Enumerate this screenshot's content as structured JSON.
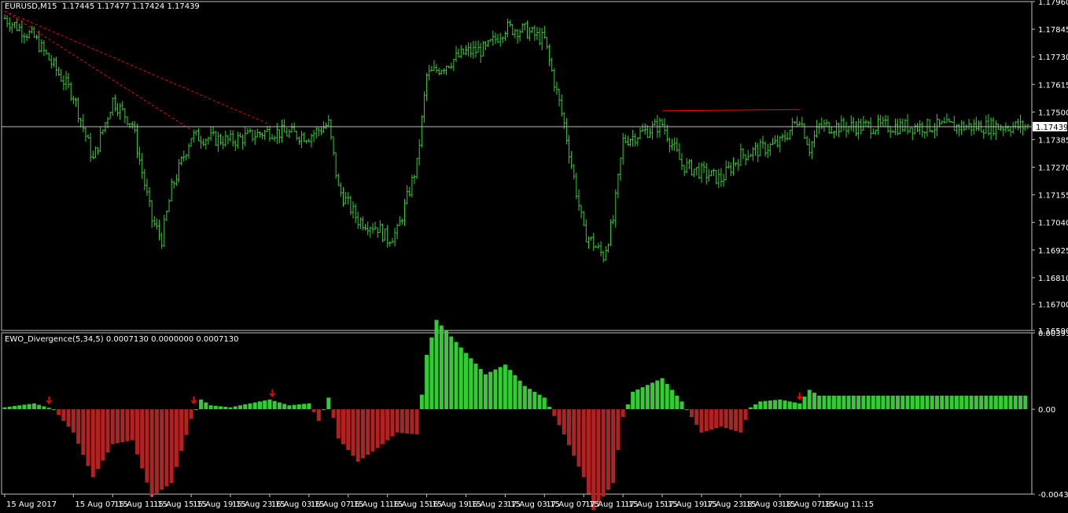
{
  "price_panel": {
    "symbol_title": "EURUSD,M15",
    "ohlc": "1.17445 1.17477 1.17424 1.17439",
    "current_price_label": "1.17439",
    "yticks": [
      "1.17960",
      "1.17845",
      "1.17730",
      "1.17615",
      "1.17500",
      "1.17385",
      "1.17270",
      "1.17155",
      "1.17040",
      "1.16925",
      "1.16810",
      "1.16700",
      "1.16590"
    ]
  },
  "indicator_panel": {
    "title": "EWO_Divergence(5,34,5) 0.0007130 0.0000000 0.0007130",
    "yticks": [
      "0.003936",
      "0.00",
      "-0.004371"
    ]
  },
  "time_axis": [
    "15 Aug 2017",
    "15 Aug 07:15",
    "15 Aug 11:15",
    "15 Aug 15:15",
    "15 Aug 19:15",
    "15 Aug 23:15",
    "16 Aug 03:15",
    "16 Aug 07:15",
    "16 Aug 11:15",
    "16 Aug 15:15",
    "16 Aug 19:15",
    "16 Aug 23:15",
    "17 Aug 03:15",
    "17 Aug 07:15",
    "17 Aug 11:15",
    "17 Aug 15:15",
    "17 Aug 19:15",
    "17 Aug 23:15",
    "18 Aug 03:15",
    "18 Aug 07:15",
    "18 Aug 11:15"
  ],
  "colors": {
    "background": "#000000",
    "bull": "#32CD32",
    "bear": "#B22222",
    "grid": "#C0C0C0",
    "line": "#FF0000",
    "arrow": "#FF0000"
  },
  "chart_data": [
    {
      "type": "line",
      "title": "EURUSD,M15",
      "ylim": [
        1.1659,
        1.1796
      ],
      "series": [
        {
          "name": "EURUSD",
          "points_anchor": [
            [
              "15 Aug 2017",
              1.1789
            ],
            [
              "15 Aug 03:15",
              1.1781
            ],
            [
              "15 Aug 07:15",
              1.1757
            ],
            [
              "15 Aug 09:15",
              1.173
            ],
            [
              "15 Aug 11:15",
              1.1755
            ],
            [
              "15 Aug 13:15",
              1.1745
            ],
            [
              "15 Aug 15:15",
              1.1705
            ],
            [
              "15 Aug 16:15",
              1.1697
            ],
            [
              "15 Aug 17:15",
              1.1718
            ],
            [
              "15 Aug 19:15",
              1.174
            ],
            [
              "15 Aug 23:15",
              1.1738
            ],
            [
              "16 Aug 03:15",
              1.1742
            ],
            [
              "16 Aug 07:15",
              1.174
            ],
            [
              "16 Aug 09:15",
              1.1745
            ],
            [
              "16 Aug 10:15",
              1.1718
            ],
            [
              "16 Aug 12:15",
              1.1705
            ],
            [
              "16 Aug 14:15",
              1.1702
            ],
            [
              "16 Aug 15:15",
              1.1697
            ],
            [
              "16 Aug 16:15",
              1.17
            ],
            [
              "16 Aug 18:15",
              1.1728
            ],
            [
              "16 Aug 19:15",
              1.1765
            ],
            [
              "16 Aug 23:15",
              1.1775
            ],
            [
              "17 Aug 01:15",
              1.1776
            ],
            [
              "17 Aug 03:15",
              1.1785
            ],
            [
              "17 Aug 05:15",
              1.1784
            ],
            [
              "17 Aug 07:15",
              1.178
            ],
            [
              "17 Aug 09:15",
              1.1745
            ],
            [
              "17 Aug 11:15",
              1.17
            ],
            [
              "17 Aug 13:15",
              1.169
            ],
            [
              "17 Aug 14:15",
              1.1705
            ],
            [
              "17 Aug 15:15",
              1.1738
            ],
            [
              "17 Aug 19:15",
              1.1745
            ],
            [
              "17 Aug 21:15",
              1.1728
            ],
            [
              "17 Aug 23:15",
              1.1725
            ],
            [
              "18 Aug 01:15",
              1.1722
            ],
            [
              "18 Aug 03:15",
              1.1732
            ],
            [
              "18 Aug 07:15",
              1.1737
            ],
            [
              "18 Aug 09:15",
              1.1748
            ],
            [
              "18 Aug 10:15",
              1.1735
            ],
            [
              "18 Aug 11:15",
              1.1744
            ]
          ]
        }
      ]
    },
    {
      "type": "bar",
      "title": "EWO_Divergence(5,34,5)",
      "ylim": [
        -0.004371,
        0.003936
      ],
      "series": [
        {
          "name": "EWO",
          "anchors": [
            [
              "15 Aug 2017",
              0.0001
            ],
            [
              "15 Aug 03:15",
              0.0003
            ],
            [
              "15 Aug 05:15",
              0.0
            ],
            [
              "15 Aug 07:15",
              -0.0012
            ],
            [
              "15 Aug 09:15",
              -0.0035
            ],
            [
              "15 Aug 11:15",
              -0.0018
            ],
            [
              "15 Aug 13:15",
              -0.0016
            ],
            [
              "15 Aug 15:15",
              -0.0045
            ],
            [
              "15 Aug 17:15",
              -0.0038
            ],
            [
              "15 Aug 19:15",
              -0.0005
            ],
            [
              "15 Aug 20:15",
              0.0005
            ],
            [
              "15 Aug 21:15",
              0.0002
            ],
            [
              "15 Aug 23:15",
              0.0001
            ],
            [
              "16 Aug 02:15",
              0.0004
            ],
            [
              "16 Aug 03:15",
              0.0005
            ],
            [
              "16 Aug 05:15",
              0.0002
            ],
            [
              "16 Aug 07:15",
              0.0003
            ],
            [
              "16 Aug 08:15",
              -0.0006
            ],
            [
              "16 Aug 09:15",
              0.0006
            ],
            [
              "16 Aug 10:15",
              -0.0015
            ],
            [
              "16 Aug 12:15",
              -0.0027
            ],
            [
              "16 Aug 14:15",
              -0.002
            ],
            [
              "16 Aug 16:15",
              -0.0012
            ],
            [
              "16 Aug 18:15",
              -0.0013
            ],
            [
              "16 Aug 19:15",
              0.0028
            ],
            [
              "16 Aug 20:15",
              0.0046
            ],
            [
              "16 Aug 23:15",
              0.0029
            ],
            [
              "17 Aug 01:15",
              0.0018
            ],
            [
              "17 Aug 03:15",
              0.0023
            ],
            [
              "17 Aug 05:15",
              0.0012
            ],
            [
              "17 Aug 07:15",
              0.0006
            ],
            [
              "17 Aug 09:15",
              -0.0013
            ],
            [
              "17 Aug 11:15",
              -0.0035
            ],
            [
              "17 Aug 12:15",
              -0.0052
            ],
            [
              "17 Aug 14:15",
              -0.0038
            ],
            [
              "17 Aug 15:15",
              -0.0004
            ],
            [
              "17 Aug 16:15",
              0.0009
            ],
            [
              "17 Aug 19:15",
              0.0016
            ],
            [
              "17 Aug 21:15",
              0.0004
            ],
            [
              "17 Aug 23:15",
              -0.0012
            ],
            [
              "18 Aug 01:15",
              -0.0009
            ],
            [
              "18 Aug 03:15",
              -0.0012
            ],
            [
              "18 Aug 04:15",
              0.0001
            ],
            [
              "18 Aug 05:15",
              0.0004
            ],
            [
              "18 Aug 07:15",
              0.0005
            ],
            [
              "18 Aug 09:15",
              0.0003
            ],
            [
              "18 Aug 10:15",
              0.001
            ],
            [
              "18 Aug 11:15",
              0.0007
            ]
          ]
        }
      ]
    }
  ]
}
